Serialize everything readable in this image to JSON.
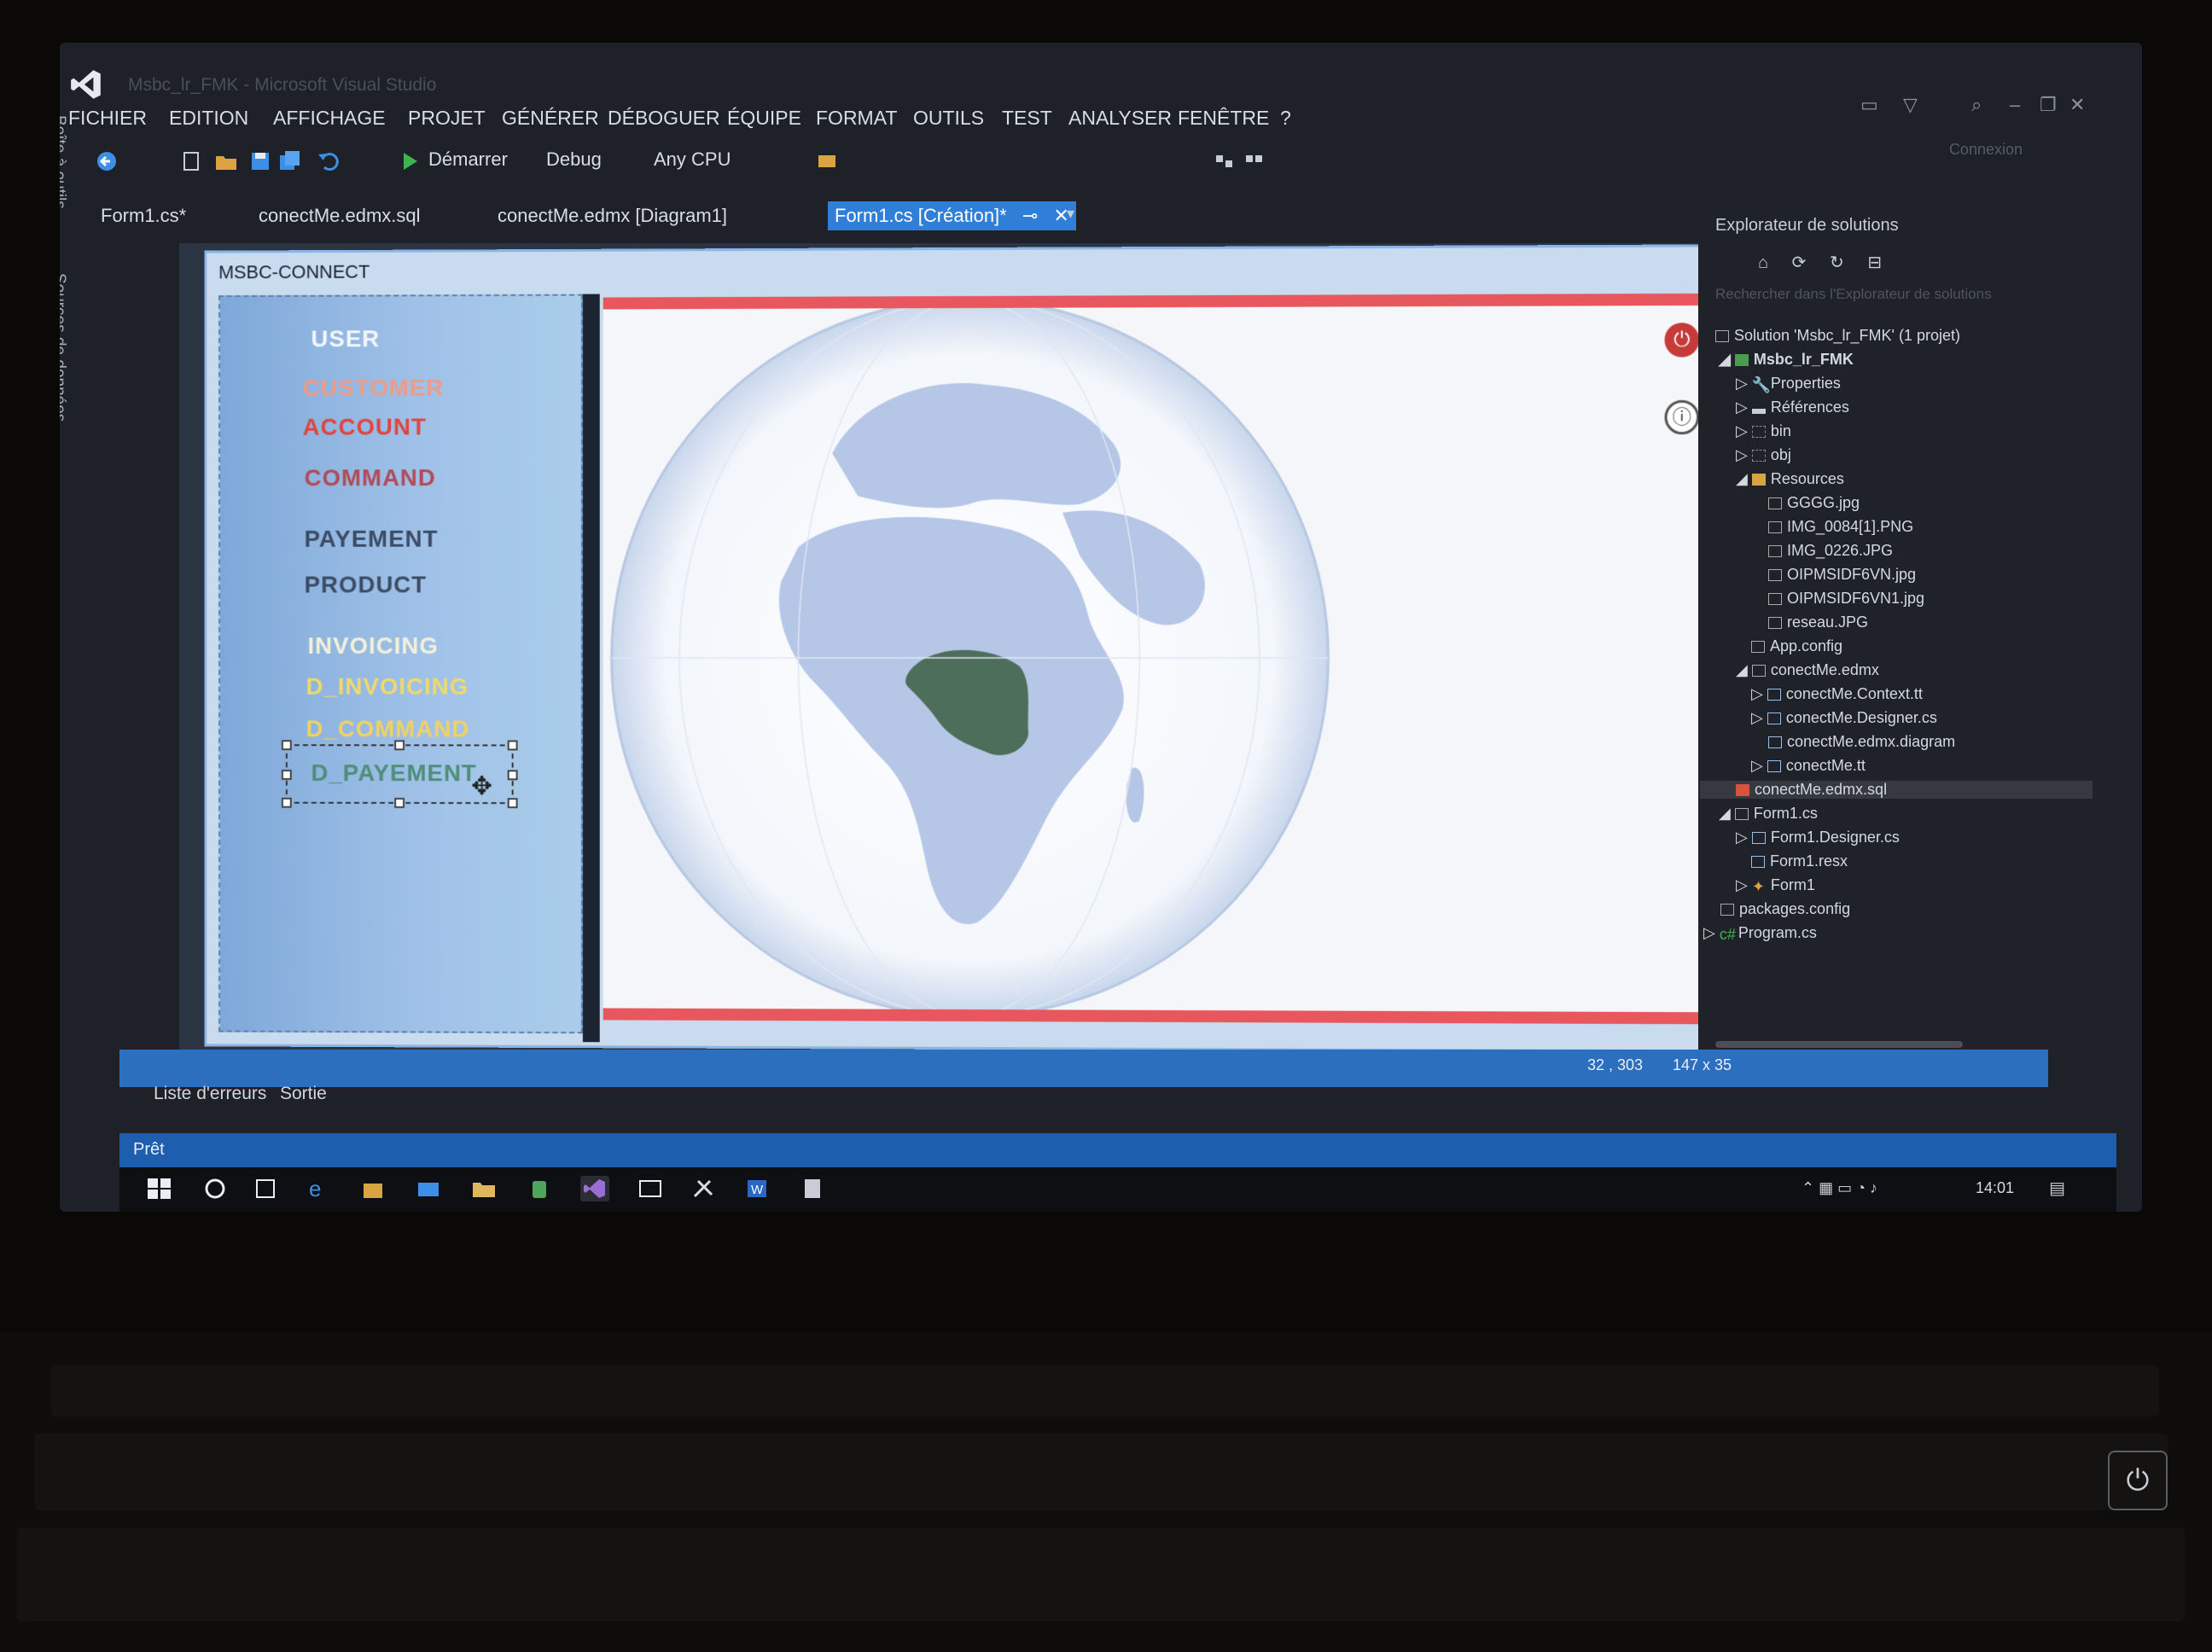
{
  "app": {
    "window_title": "Msbc_lr_FMK - Microsoft Visual Studio",
    "connexion": "Connexion"
  },
  "menu": [
    "FICHIER",
    "EDITION",
    "AFFICHAGE",
    "PROJET",
    "GÉNÉRER",
    "DÉBOGUER",
    "ÉQUIPE",
    "FORMAT",
    "OUTILS",
    "TEST",
    "ANALYSER",
    "FENÊTRE",
    "?"
  ],
  "toolbar": {
    "start_label": "Démarrer",
    "config": "Debug",
    "platform": "Any CPU"
  },
  "tabs": [
    {
      "label": "Form1.cs*"
    },
    {
      "label": "conectMe.edmx.sql"
    },
    {
      "label": "conectMe.edmx [Diagram1]"
    },
    {
      "label": "Form1.cs [Création]*"
    }
  ],
  "left_strip": {
    "toolbox": "Boîte à outils",
    "datasources": "Sources de données"
  },
  "form": {
    "title": "MSBC-CONNECT",
    "nav": [
      {
        "label": "USER",
        "color": "#f2f6fb"
      },
      {
        "label": "CUSTOMER",
        "color": "#ef9b86"
      },
      {
        "label": "ACCOUNT",
        "color": "#e0453e"
      },
      {
        "label": "COMMAND",
        "color": "#b14b58"
      },
      {
        "label": "PAYEMENT",
        "color": "#3c4c64"
      },
      {
        "label": "PRODUCT",
        "color": "#3c4c64"
      },
      {
        "label": "INVOICING",
        "color": "#f3f0d8"
      },
      {
        "label": "D_INVOICING",
        "color": "#efd96c"
      },
      {
        "label": "D_COMMAND",
        "color": "#f0d262"
      },
      {
        "label": "D_PAYEMENT",
        "color": "#4f8e78"
      }
    ]
  },
  "solution_explorer": {
    "title": "Explorateur de solutions",
    "search_placeholder": "Rechercher dans l'Explorateur de solutions",
    "items": [
      {
        "label": "Solution 'Msbc_lr_FMK' (1 projet)"
      },
      {
        "label": "Msbc_lr_FMK"
      },
      {
        "label": "Properties"
      },
      {
        "label": "Références"
      },
      {
        "label": "bin"
      },
      {
        "label": "obj"
      },
      {
        "label": "Resources"
      },
      {
        "label": "GGGG.jpg"
      },
      {
        "label": "IMG_0084[1].PNG"
      },
      {
        "label": "IMG_0226.JPG"
      },
      {
        "label": "OIPMSIDF6VN.jpg"
      },
      {
        "label": "OIPMSIDF6VN1.jpg"
      },
      {
        "label": "reseau.JPG"
      },
      {
        "label": "App.config"
      },
      {
        "label": "conectMe.edmx"
      },
      {
        "label": "conectMe.Context.tt"
      },
      {
        "label": "conectMe.Designer.cs"
      },
      {
        "label": "conectMe.edmx.diagram"
      },
      {
        "label": "conectMe.tt"
      },
      {
        "label": "conectMe.edmx.sql"
      },
      {
        "label": "Form1.cs"
      },
      {
        "label": "Form1.Designer.cs"
      },
      {
        "label": "Form1.resx"
      },
      {
        "label": "Form1"
      },
      {
        "label": "packages.config"
      },
      {
        "label": "Program.cs"
      }
    ]
  },
  "status": {
    "coords": "32 , 303",
    "size": "147 x 35",
    "ready": "Prêt"
  },
  "output_tabs": [
    "Liste d'erreurs",
    "Sortie"
  ],
  "taskbar": {
    "clock": "14:01"
  }
}
